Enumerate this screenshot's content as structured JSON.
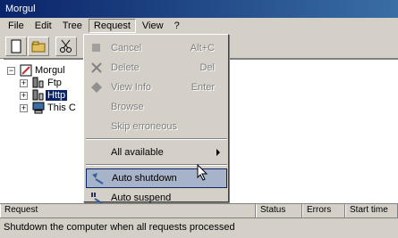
{
  "window": {
    "title": "Morgul"
  },
  "menubar": {
    "items": [
      {
        "label": "File"
      },
      {
        "label": "Edit"
      },
      {
        "label": "Tree"
      },
      {
        "label": "Request"
      },
      {
        "label": "View"
      },
      {
        "label": "?"
      }
    ]
  },
  "tree": {
    "items": [
      {
        "label": "Morgul"
      },
      {
        "label": "Ftp"
      },
      {
        "label": "Http"
      },
      {
        "label": "This C"
      }
    ]
  },
  "request_menu": {
    "items": [
      {
        "label": "Cancel",
        "shortcut": "Alt+C",
        "enabled": false
      },
      {
        "label": "Delete",
        "shortcut": "Del",
        "enabled": false
      },
      {
        "label": "View Info",
        "shortcut": "Enter",
        "enabled": false
      },
      {
        "label": "Browse",
        "shortcut": "",
        "enabled": false
      },
      {
        "label": "Skip erroneous",
        "shortcut": "",
        "enabled": false
      },
      {
        "label": "All available",
        "shortcut": "",
        "enabled": true
      },
      {
        "label": "Auto shutdown",
        "shortcut": "",
        "enabled": true,
        "highlighted": true
      },
      {
        "label": "Auto suspend",
        "shortcut": "",
        "enabled": true
      }
    ]
  },
  "list_header": {
    "columns": [
      "Request",
      "Status",
      "Errors",
      "Start time"
    ]
  },
  "statusbar": {
    "text": "Shutdown the computer when all requests processed"
  },
  "colors": {
    "title_bar": "#0a246a",
    "menu_bg": "#d4d0c8",
    "highlight": "#a6b3c8",
    "selection": "#0a246a"
  }
}
